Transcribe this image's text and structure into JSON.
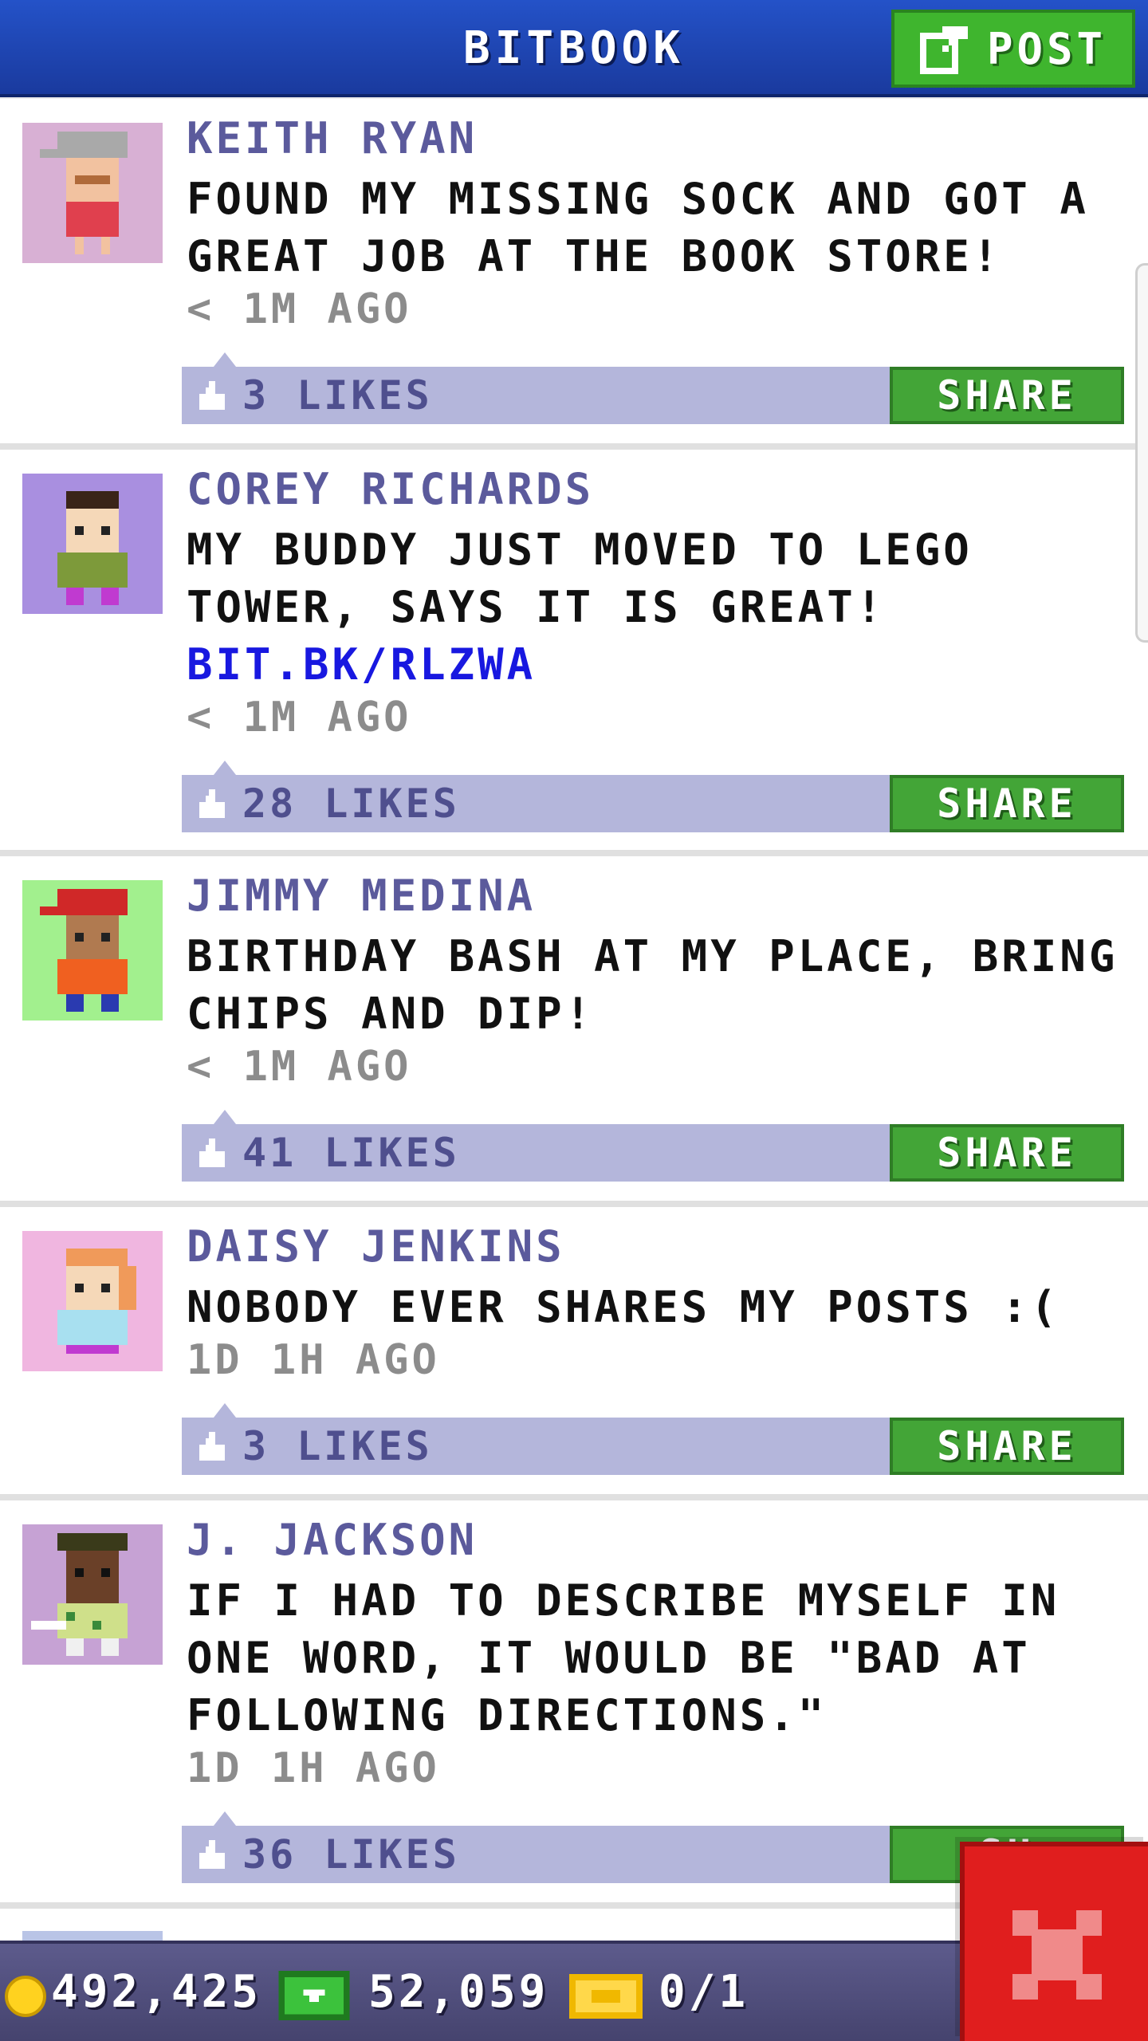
{
  "header": {
    "title": "BITBOOK",
    "post_label": "POST"
  },
  "posts": [
    {
      "name": "KEITH RYAN",
      "message": "FOUND MY MISSING SOCK AND GOT A GREAT JOB AT THE BOOK STORE!",
      "link": "",
      "time": "< 1M AGO",
      "likes": "3 LIKES",
      "share_label": "SHARE",
      "avatar_bg": "#d8b0d4"
    },
    {
      "name": "COREY RICHARDS",
      "message": "MY BUDDY JUST MOVED TO LEGO TOWER, SAYS IT IS GREAT!",
      "link": "BIT.BK/RLZWA",
      "time": "< 1M AGO",
      "likes": "28 LIKES",
      "share_label": "SHARE",
      "avatar_bg": "#a98fe0"
    },
    {
      "name": "JIMMY MEDINA",
      "message": "BIRTHDAY BASH AT MY PLACE, BRING CHIPS AND DIP!",
      "link": "",
      "time": "< 1M AGO",
      "likes": "41 LIKES",
      "share_label": "SHARE",
      "avatar_bg": "#a2f08e"
    },
    {
      "name": "DAISY JENKINS",
      "message": "NOBODY EVER SHARES MY POSTS :(",
      "link": "",
      "time": "1D 1H AGO",
      "likes": "3 LIKES",
      "share_label": "SHARE",
      "avatar_bg": "#f0b6e0"
    },
    {
      "name": "J. JACKSON",
      "message": "IF I HAD TO DESCRIBE MYSELF IN ONE WORD, IT WOULD BE \"BAD AT FOLLOWING DIRECTIONS.\"",
      "link": "",
      "time": "1D 1H AGO",
      "likes": "36 LIKES",
      "share_label": "SH",
      "avatar_bg": "#c6a2d4"
    }
  ],
  "footer": {
    "coins": "492,425",
    "bux": "52,059",
    "tickets": "0/1"
  },
  "colors": {
    "header": "#2452c8",
    "share_green": "#43a537",
    "like_bar": "#b4b6db",
    "name_purple": "#5b5a9c",
    "link_blue": "#1818e0",
    "close_red": "#e01e1e"
  },
  "icons": {
    "post": "compose-icon",
    "like": "thumbs-up-icon",
    "coin": "coin-icon",
    "bux": "bux-icon",
    "ticket": "ticket-icon",
    "close": "close-icon"
  }
}
